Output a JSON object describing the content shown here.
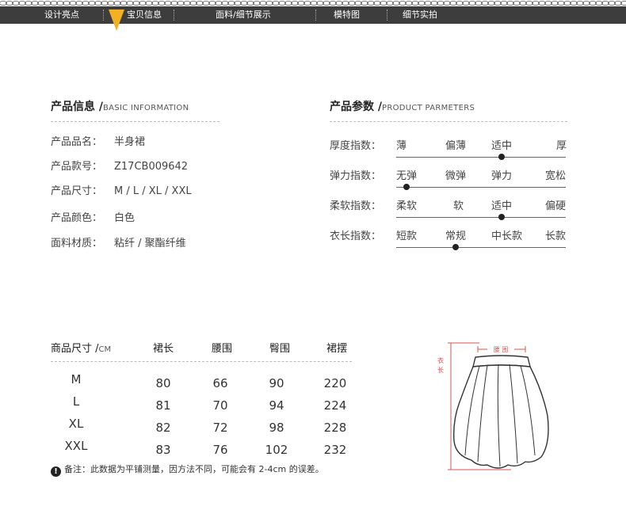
{
  "nav": {
    "items": [
      "设计亮点",
      "宝贝信息",
      "面料/细节展示",
      "模特图",
      "细节实拍"
    ],
    "active_index": 1
  },
  "info": {
    "title": "产品信息 /",
    "subtitle": "BASIC INFORMATION",
    "rows": [
      {
        "label": "产品品名：",
        "value": "半身裙"
      },
      {
        "label": "产品款号：",
        "value": "Z17CB009642"
      },
      {
        "label": "产品尺寸：",
        "value": "M / L / XL / XXL"
      },
      {
        "label": "产品颜色：",
        "value": "白色"
      },
      {
        "label": "面料材质：",
        "value": "粘纤 / 聚酯纤维"
      }
    ]
  },
  "params": {
    "title": "产品参数 /",
    "subtitle": "PRODUCT PARMETERS",
    "rows": [
      {
        "label": "厚度指数：",
        "options": [
          "薄",
          "偏薄",
          "适中",
          "厚"
        ],
        "selected": 2
      },
      {
        "label": "弹力指数：",
        "options": [
          "无弹",
          "微弹",
          "弹力",
          "宽松"
        ],
        "selected": 0
      },
      {
        "label": "柔软指数：",
        "options": [
          "柔软",
          "软",
          "适中",
          "偏硬"
        ],
        "selected": 2
      },
      {
        "label": "衣长指数：",
        "options": [
          "短款",
          "常规",
          "中长款",
          "长款"
        ],
        "selected": 1
      }
    ]
  },
  "size_table": {
    "header_label": "商品尺寸 /",
    "header_unit": "CM",
    "columns": [
      "裙长",
      "腰围",
      "臀围",
      "裙摆"
    ],
    "rows": [
      {
        "size": "M",
        "values": [
          "80",
          "66",
          "90",
          "220"
        ]
      },
      {
        "size": "L",
        "values": [
          "81",
          "70",
          "94",
          "224"
        ]
      },
      {
        "size": "XL",
        "values": [
          "82",
          "72",
          "98",
          "228"
        ]
      },
      {
        "size": "XXL",
        "values": [
          "83",
          "76",
          "102",
          "232"
        ]
      }
    ],
    "note_icon": "!",
    "note": "备注：此数据为平铺测量，因方法不同，可能会有 2-4cm 的误差。"
  },
  "diagram": {
    "waist_label": "腰 围",
    "length_label_1": "衣",
    "length_label_2": "长",
    "measure_color": "#d9534f"
  }
}
